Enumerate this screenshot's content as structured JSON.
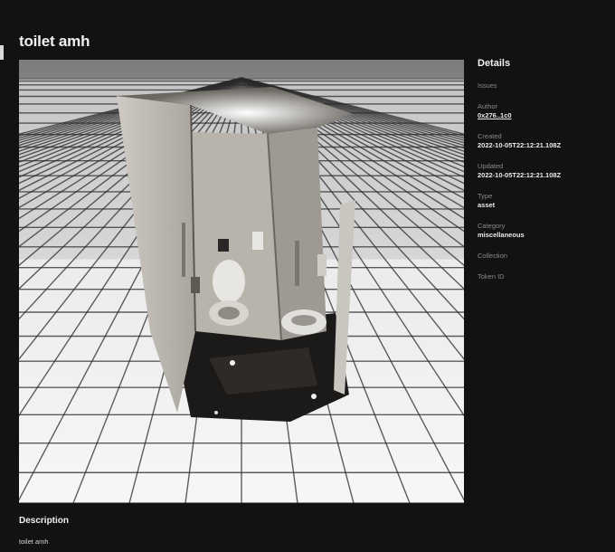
{
  "asset": {
    "title": "toilet amh"
  },
  "details": {
    "heading": "Details",
    "issues_label": "Issues",
    "author_label": "Author",
    "author_value": "0x276..1c0",
    "created_label": "Created",
    "created_value": "2022-10-05T22:12:21.108Z",
    "updated_label": "Updated",
    "updated_value": "2022-10-05T22:12:21.108Z",
    "type_label": "Type",
    "type_value": "asset",
    "category_label": "Category",
    "category_value": "miscellaneous",
    "collection_label": "Collection",
    "token_label": "Token ID"
  },
  "description": {
    "heading": "Description",
    "text": "toilet amh"
  },
  "colors": {
    "background": "#121212",
    "floor_tile": "#ffffff",
    "grid_line": "#2a2a2a"
  },
  "icons": [
    "model-viewer"
  ]
}
